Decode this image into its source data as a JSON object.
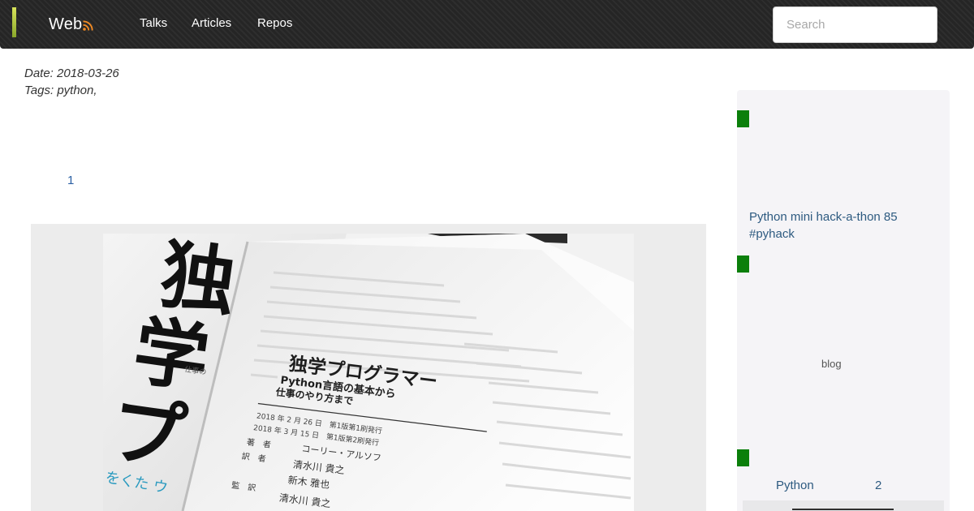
{
  "header": {
    "brand": "Web",
    "brand_icon": "rss-icon",
    "nav": [
      {
        "label": "Talks"
      },
      {
        "label": "Articles"
      },
      {
        "label": "Repos"
      }
    ],
    "search_placeholder": "Search",
    "colors": {
      "navbar": "#252525",
      "accent": "#c6d646",
      "rss": "#f08a24"
    }
  },
  "post": {
    "date_label": "Date:",
    "date": "2018-03-26",
    "tags_label": "Tags:",
    "tags": [
      "python"
    ],
    "list_number": "1",
    "photo": {
      "title": "独学プログラマー",
      "subtitle_1": "Python言語の基本から",
      "subtitle_2": "仕事のやり方まで",
      "edition_1": "2018 年 2 月 26 日　第1版第1刷発行",
      "edition_2": "2018 年 3 月 15 日　第1版第2刷発行",
      "role_author": "著　者",
      "author": "コーリー・アルソフ",
      "role_translator": "訳　者",
      "translator_1": "清水川 貴之",
      "translator_2": "新木 雅也",
      "role_supervisor": "監　訳",
      "supervisor": "清水川 貴之",
      "cover_kanji_1": "独",
      "cover_kanji_2": "学",
      "cover_kana": "プ",
      "cover_side": "仕事の",
      "cover_blue": "をくた ウ"
    }
  },
  "sidebar": {
    "recent_post": "Python mini hack-a-thon 85 #pyhack",
    "blog_label": "blog",
    "category": {
      "name": "Python",
      "count": "2"
    },
    "colors": {
      "marker": "#0b7f0b",
      "background": "#f5f4f7",
      "link": "#2d5a80"
    }
  }
}
